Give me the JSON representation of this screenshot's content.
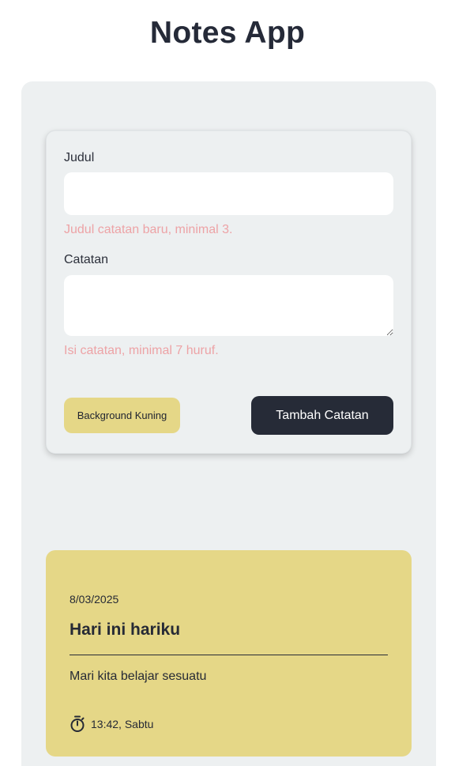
{
  "app": {
    "title": "Notes App"
  },
  "form": {
    "title_label": "Judul",
    "title_value": "",
    "title_hint": "Judul catatan baru, minimal 3.",
    "note_label": "Catatan",
    "note_value": "",
    "note_hint": "Isi catatan, minimal 7 huruf.",
    "bg_button_label": "Background Kuning",
    "add_button_label": "Tambah Catatan"
  },
  "notes": [
    {
      "date": "8/03/2025",
      "title": "Hari ini hariku",
      "body": "Mari kita belajar sesuatu",
      "time": "13:42, Sabtu",
      "time_icon": "timer-icon",
      "background_color": "#e5d787"
    }
  ],
  "colors": {
    "accent_dark": "#262b37",
    "yellow": "#e5d787",
    "hint_red": "#eda3a6",
    "panel_bg": "#edf0f1"
  }
}
